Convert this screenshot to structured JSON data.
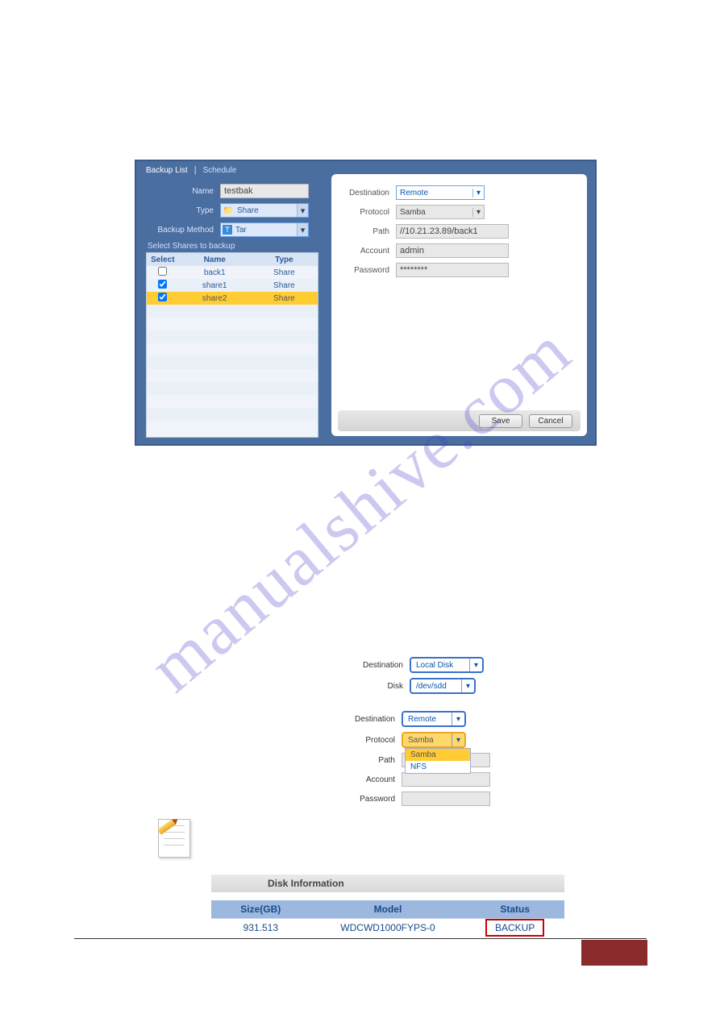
{
  "watermark_text": "manualshive.com",
  "dialog": {
    "tabs": {
      "active": "Backup List",
      "other": "Schedule",
      "sep": "|"
    },
    "fields": {
      "name_label": "Name",
      "name_value": "testbak",
      "type_label": "Type",
      "type_value": "Share",
      "method_label": "Backup Method",
      "method_value": "Tar"
    },
    "shares_heading": "Select Shares to backup",
    "shares_table": {
      "head": {
        "select": "Select",
        "name": "Name",
        "type": "Type"
      },
      "rows": [
        {
          "checked": false,
          "name": "back1",
          "type": "Share",
          "selected": false
        },
        {
          "checked": true,
          "name": "share1",
          "type": "Share",
          "selected": false
        },
        {
          "checked": true,
          "name": "share2",
          "type": "Share",
          "selected": true
        }
      ]
    },
    "right": {
      "dest_label": "Destination",
      "dest_value": "Remote",
      "proto_label": "Protocol",
      "proto_value": "Samba",
      "path_label": "Path",
      "path_value": "//10.21.23.89/back1",
      "acct_label": "Account",
      "acct_value": "admin",
      "pwd_label": "Password",
      "pwd_value": "********"
    },
    "buttons": {
      "save": "Save",
      "cancel": "Cancel"
    }
  },
  "block_local": {
    "dest_label": "Destination",
    "dest_value": "Local Disk",
    "disk_label": "Disk",
    "disk_value": "/dev/sdd"
  },
  "block_remote": {
    "dest_label": "Destination",
    "dest_value": "Remote",
    "proto_label": "Protocol",
    "proto_value": "Samba",
    "path_label": "Path",
    "path_value": "",
    "acct_label": "Account",
    "acct_value": "",
    "pwd_label": "Password",
    "pwd_value": "",
    "dropdown": {
      "opt1": "Samba",
      "opt2": "NFS"
    }
  },
  "disk_info": {
    "title": "Disk Information",
    "head": {
      "size": "Size(GB)",
      "model": "Model",
      "status": "Status"
    },
    "row": {
      "size": "931.513",
      "model": "WDCWD1000FYPS-0",
      "status": "BACKUP"
    }
  }
}
